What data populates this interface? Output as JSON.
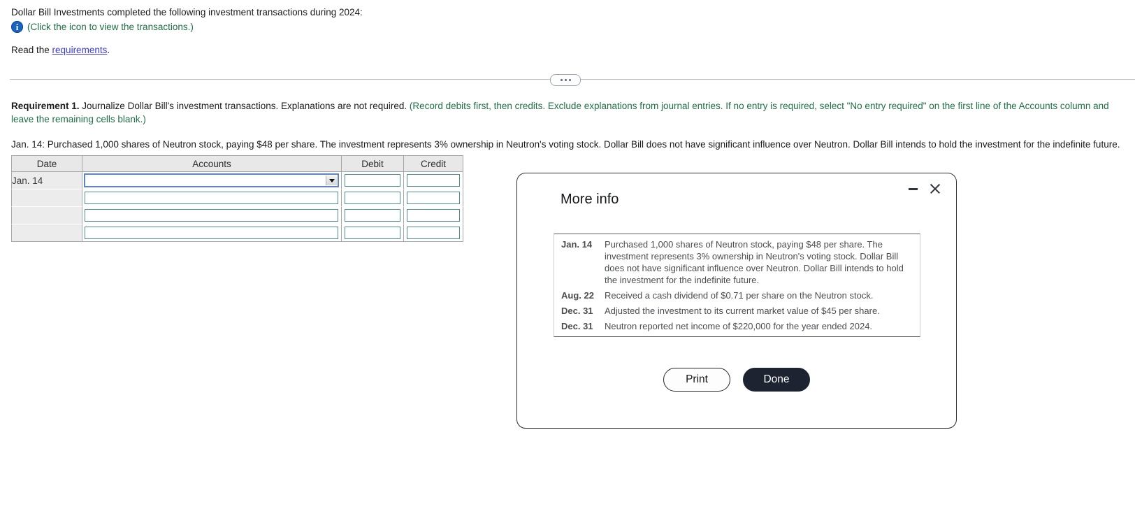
{
  "intro": {
    "statement": "Dollar Bill Investments completed the following investment transactions during 2024:",
    "icon_name": "info-icon",
    "icon_hint": "(Click the icon to view the transactions.)",
    "read_prefix": "Read the ",
    "read_link": "requirements",
    "read_suffix": "."
  },
  "splitter": {
    "handle_name": "splitter-handle",
    "dots": 3
  },
  "requirement": {
    "label": "Requirement 1.",
    "text": " Journalize Dollar Bill's investment transactions. Explanations are not required. ",
    "hint": "(Record debits first, then credits. Exclude explanations from journal entries. If no entry is required, select \"No entry required\" on the first line of the Accounts column and leave the remaining cells blank.)",
    "prompt": "Jan. 14: Purchased 1,000 shares of Neutron stock, paying $48 per share. The investment represents 3% ownership in Neutron's voting stock. Dollar Bill does not have significant influence over Neutron. Dollar Bill intends to hold the investment for the indefinite future."
  },
  "journal": {
    "headers": [
      "Date",
      "Accounts",
      "Debit",
      "Credit"
    ],
    "rows": [
      {
        "date": "Jan. 14",
        "account": "",
        "debit": "",
        "credit": "",
        "account_is_select": true
      },
      {
        "date": "",
        "account": "",
        "debit": "",
        "credit": "",
        "account_is_select": false
      },
      {
        "date": "",
        "account": "",
        "debit": "",
        "credit": "",
        "account_is_select": false
      },
      {
        "date": "",
        "account": "",
        "debit": "",
        "credit": "",
        "account_is_select": false
      }
    ],
    "account_select_placeholder": ""
  },
  "dialog": {
    "title": "More info",
    "minimize_name": "minimize-icon",
    "close_name": "close-icon",
    "transactions": [
      {
        "date": "Jan. 14",
        "text": "Purchased 1,000 shares of Neutron stock, paying $48 per share. The investment represents 3% ownership in Neutron's voting stock. Dollar Bill does not have significant influence over Neutron. Dollar Bill intends to hold the investment for the indefinite future."
      },
      {
        "date": "Aug. 22",
        "text": "Received a cash dividend of $0.71 per share on the Neutron stock."
      },
      {
        "date": "Dec. 31",
        "text": "Adjusted the investment to its current market value of $45 per share."
      },
      {
        "date": "Dec. 31",
        "text": "Neutron reported net income of $220,000 for the year ended 2024."
      }
    ],
    "print_label": "Print",
    "done_label": "Done"
  },
  "colors": {
    "hint_green": "#1d7044",
    "link_blue": "#3a3ad6",
    "info_blue": "#1565c0",
    "done_bg": "#1d2330",
    "cell_border": "#4c8c93",
    "select_border": "#5b87c7",
    "header_bg": "#e8e8e8"
  }
}
